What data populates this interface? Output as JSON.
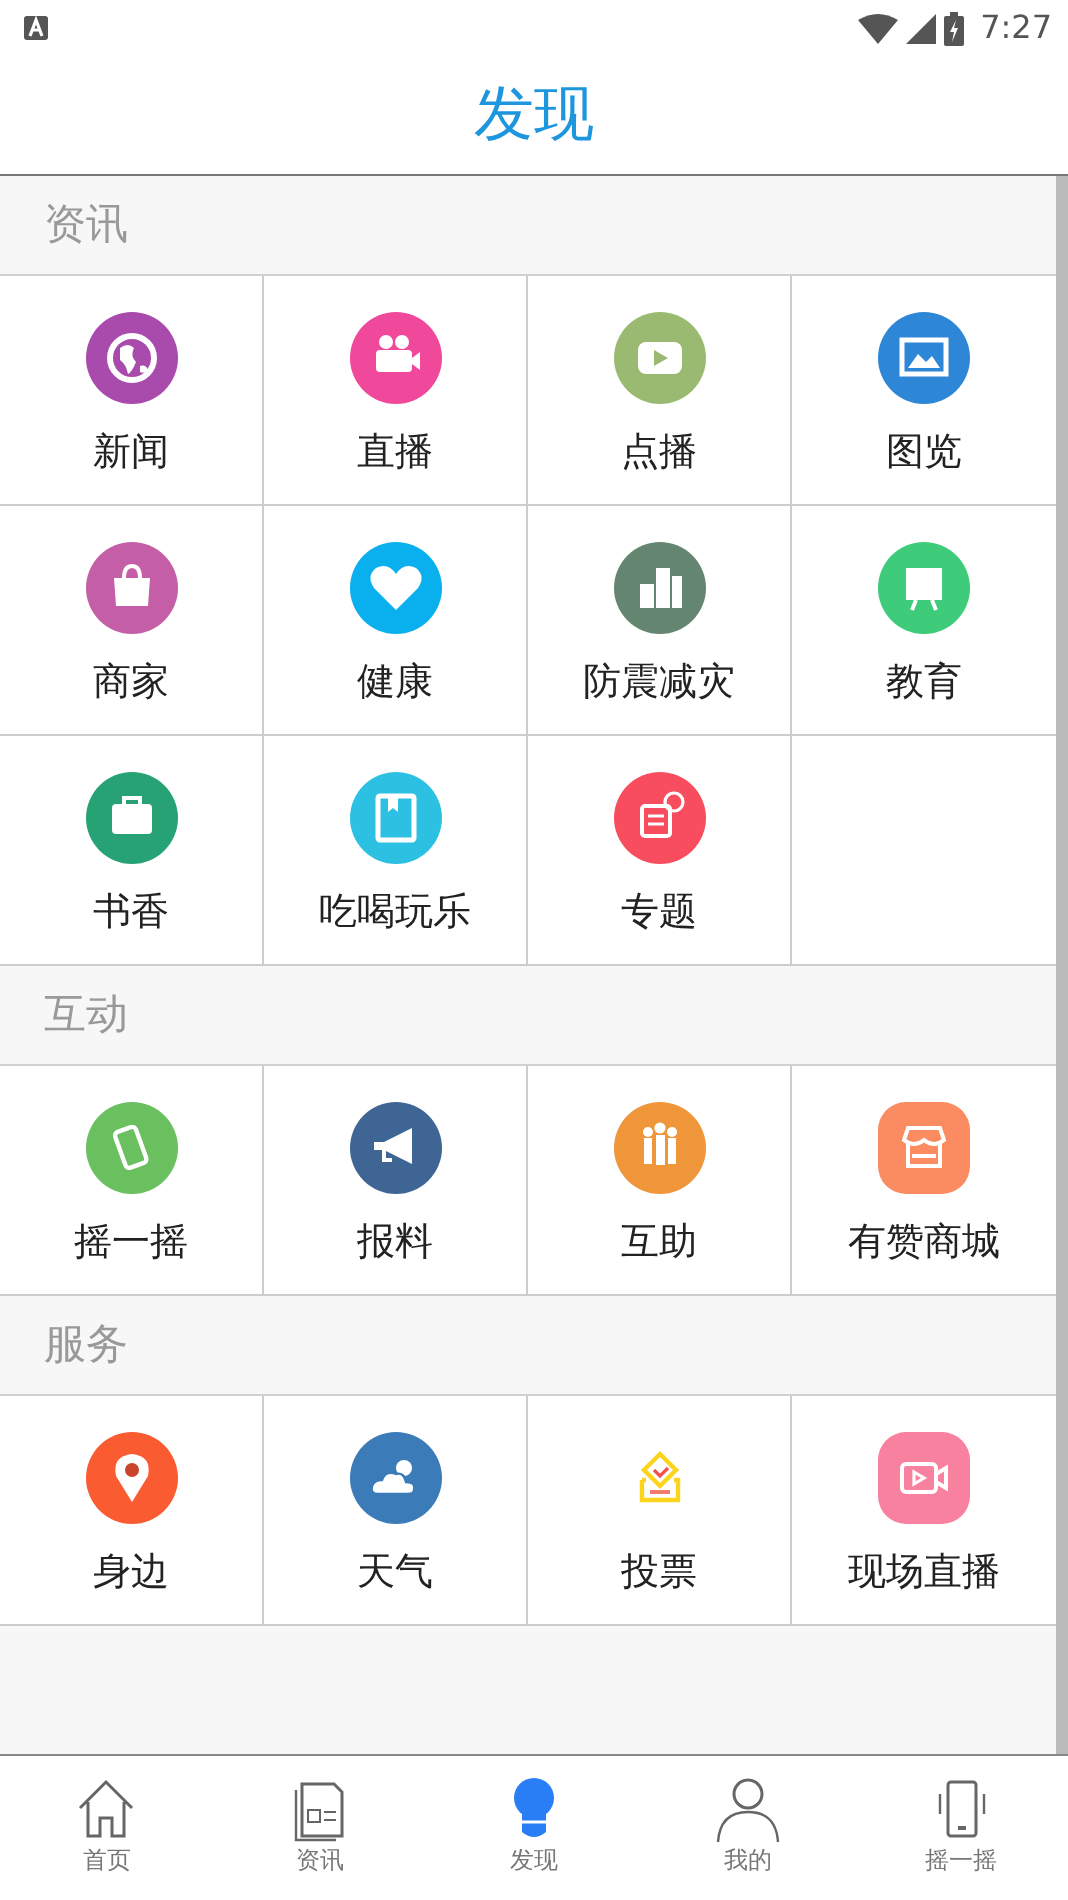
{
  "status_bar": {
    "time": "7:27"
  },
  "header": {
    "title": "发现"
  },
  "sections": [
    {
      "title": "资讯",
      "items": [
        {
          "label": "新闻",
          "kind": "circle",
          "color": "#a94aad"
        },
        {
          "label": "直播",
          "kind": "circle",
          "color": "#f0489a"
        },
        {
          "label": "点播",
          "kind": "circle",
          "color": "#9aba72"
        },
        {
          "label": "图览",
          "kind": "circle",
          "color": "#2e86d6"
        },
        {
          "label": "商家",
          "kind": "circle",
          "color": "#c45ea6"
        },
        {
          "label": "健康",
          "kind": "circle",
          "color": "#0ab0ee"
        },
        {
          "label": "防震减灾",
          "kind": "circle",
          "color": "#648570"
        },
        {
          "label": "教育",
          "kind": "circle",
          "color": "#3ecb7a"
        },
        {
          "label": "书香",
          "kind": "circle",
          "color": "#26a274"
        },
        {
          "label": "吃喝玩乐",
          "kind": "circle",
          "color": "#2cc0e2"
        },
        {
          "label": "专题",
          "kind": "circle",
          "color": "#f74d5e"
        }
      ]
    },
    {
      "title": "互动",
      "items": [
        {
          "label": "摇一摇",
          "kind": "circle",
          "color": "#6abf5e"
        },
        {
          "label": "报料",
          "kind": "circle",
          "color": "#3e6594"
        },
        {
          "label": "互助",
          "kind": "circle",
          "color": "#f0963a"
        },
        {
          "label": "有赞商城",
          "kind": "rounded",
          "color": "#fb8b60"
        }
      ]
    },
    {
      "title": "服务",
      "items": [
        {
          "label": "身边",
          "kind": "circle",
          "color": "#fb5b31"
        },
        {
          "label": "天气",
          "kind": "circle",
          "color": "#3b7bb8"
        },
        {
          "label": "投票",
          "kind": "outline",
          "color": "#fcd41c"
        },
        {
          "label": "现场直播",
          "kind": "rounded",
          "color": "#f7819e"
        }
      ]
    }
  ],
  "tab_bar": [
    {
      "label": "首页",
      "selected": false
    },
    {
      "label": "资讯",
      "selected": false
    },
    {
      "label": "发现",
      "selected": true
    },
    {
      "label": "我的",
      "selected": false
    },
    {
      "label": "摇一摇",
      "selected": false
    }
  ]
}
